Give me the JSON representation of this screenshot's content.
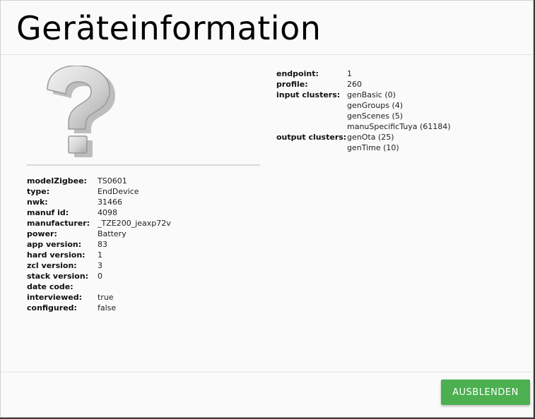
{
  "dialog": {
    "title": "Geräteinformation",
    "hide_button_label": "AUSBLENDEN",
    "device_image_icon": "question-mark-icon"
  },
  "device_info": {
    "rows": [
      {
        "key": "modelZigbee:",
        "value": "TS0601"
      },
      {
        "key": "type:",
        "value": "EndDevice"
      },
      {
        "key": "nwk:",
        "value": "31466"
      },
      {
        "key": "manuf id:",
        "value": "4098"
      },
      {
        "key": "manufacturer:",
        "value": "_TZE200_jeaxp72v"
      },
      {
        "key": "power:",
        "value": "Battery"
      },
      {
        "key": "app version:",
        "value": "83"
      },
      {
        "key": "hard version:",
        "value": "1"
      },
      {
        "key": "zcl version:",
        "value": "3"
      },
      {
        "key": "stack version:",
        "value": "0"
      },
      {
        "key": "date code:",
        "value": ""
      },
      {
        "key": "interviewed:",
        "value": "true"
      },
      {
        "key": "configured:",
        "value": "false"
      }
    ]
  },
  "endpoint_info": {
    "endpoint_key": "endpoint:",
    "endpoint": "1",
    "profile_key": "profile:",
    "profile": "260",
    "input_clusters_key": "input clusters:",
    "input_clusters": [
      "genBasic (0)",
      "genGroups (4)",
      "genScenes (5)",
      "manuSpecificTuya (61184)"
    ],
    "output_clusters_key": "output clusters:",
    "output_clusters": [
      "genOta (25)",
      "genTime (10)"
    ]
  },
  "colors": {
    "button": "#4caf50",
    "dialog_bg": "#fafafa"
  }
}
